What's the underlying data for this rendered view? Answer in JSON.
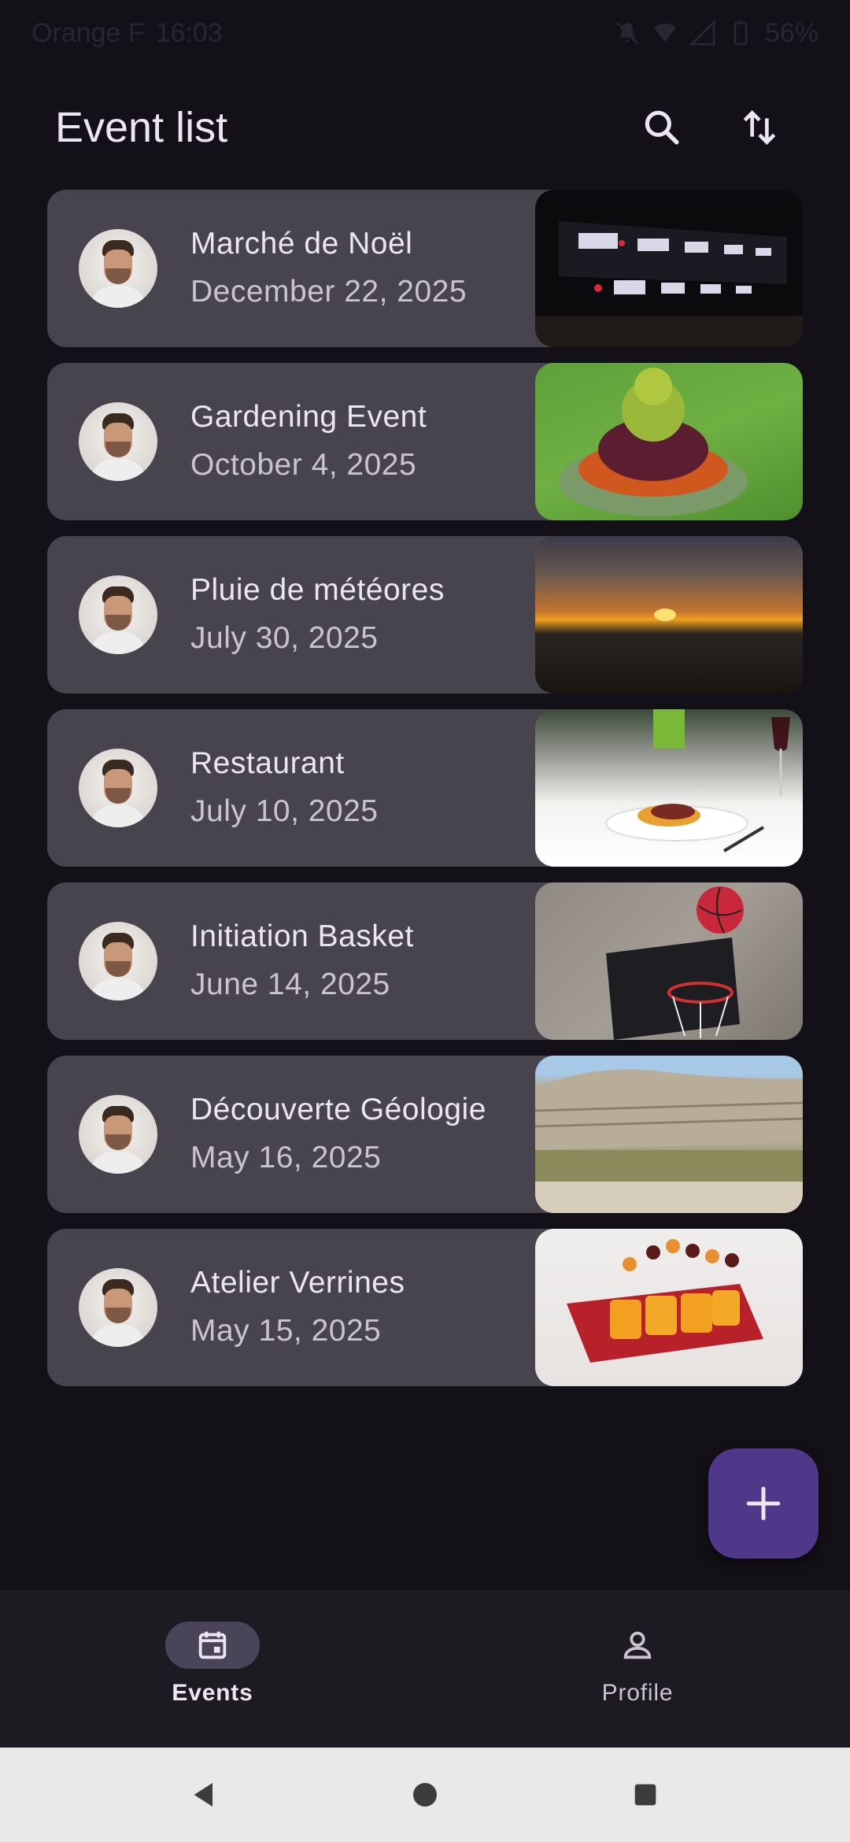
{
  "status_bar": {
    "carrier": "Orange F",
    "time": "16:03",
    "battery": "56%"
  },
  "app_bar": {
    "title": "Event list",
    "search_icon": "search-icon",
    "sort_icon": "swap-vert-icon"
  },
  "events": [
    {
      "title": "Marché de Noël",
      "date": "December 22, 2025",
      "image": "christmas-market-lights"
    },
    {
      "title": "Gardening Event",
      "date": "October 4, 2025",
      "image": "flower-bed"
    },
    {
      "title": "Pluie de météores",
      "date": "July 30, 2025",
      "image": "sunset-sky"
    },
    {
      "title": "Restaurant",
      "date": "July 10, 2025",
      "image": "plated-dish-with-wine"
    },
    {
      "title": "Initiation Basket",
      "date": "June 14, 2025",
      "image": "basketball-hoop"
    },
    {
      "title": "Découverte Géologie",
      "date": "May 16, 2025",
      "image": "rock-cliff-landscape"
    },
    {
      "title": "Atelier Verrines",
      "date": "May 15, 2025",
      "image": "verrines-tray"
    }
  ],
  "fab": {
    "icon": "add-icon"
  },
  "bottom_nav": {
    "items": [
      {
        "label": "Events",
        "icon": "calendar-icon",
        "active": true
      },
      {
        "label": "Profile",
        "icon": "person-icon",
        "active": false
      }
    ]
  },
  "colors": {
    "background": "#131017",
    "card": "#48444d",
    "fab": "#4f378a",
    "nav_bar": "#1d1a22",
    "nav_indicator": "#4a4458"
  }
}
